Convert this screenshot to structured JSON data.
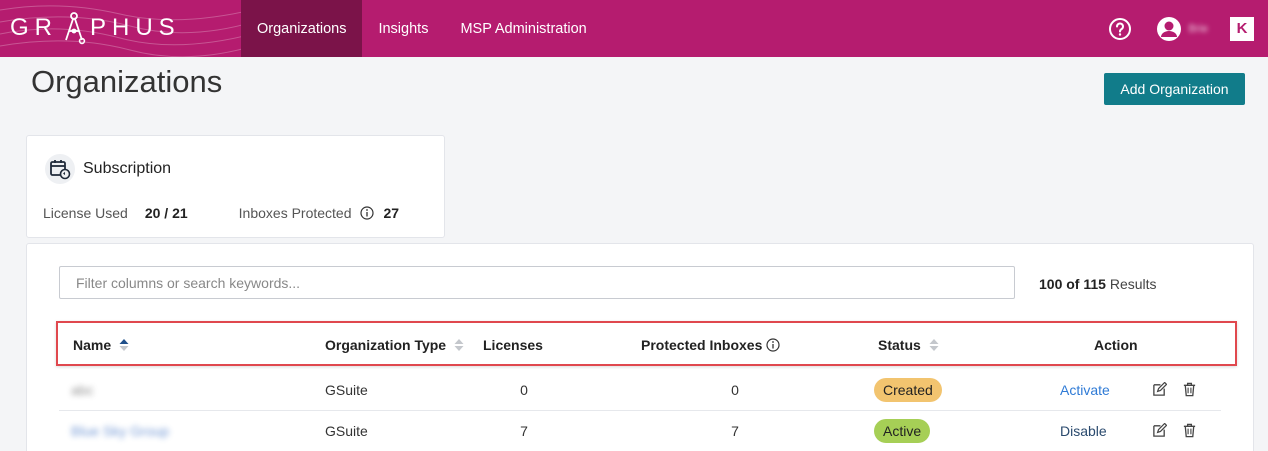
{
  "header": {
    "logo_text_left": "GR",
    "logo_text_right": "PHUS",
    "nav": [
      {
        "label": "Organizations",
        "active": true
      },
      {
        "label": "Insights",
        "active": false
      },
      {
        "label": "MSP Administration",
        "active": false
      }
    ],
    "user_name": "Brie",
    "brand_badge": "K",
    "accent_color": "#b51c6f"
  },
  "page": {
    "title": "Organizations",
    "add_button_label": "Add Organization"
  },
  "subscription": {
    "title": "Subscription",
    "license_used_label": "License Used",
    "license_used_value": "20 / 21",
    "inboxes_protected_label": "Inboxes Protected",
    "inboxes_protected_value": "27"
  },
  "table": {
    "search_placeholder": "Filter columns or search keywords...",
    "results_count": "100 of 115",
    "results_suffix": "Results",
    "columns": {
      "name": "Name",
      "org_type": "Organization Type",
      "licenses": "Licenses",
      "protected_inboxes": "Protected Inboxes",
      "status": "Status",
      "action": "Action"
    },
    "rows": [
      {
        "name": "abc",
        "org_type": "GSuite",
        "licenses": "0",
        "protected_inboxes": "0",
        "status": "Created",
        "action": "Activate"
      },
      {
        "name": "Blue Sky Group",
        "org_type": "GSuite",
        "licenses": "7",
        "protected_inboxes": "7",
        "status": "Active",
        "action": "Disable"
      }
    ]
  }
}
